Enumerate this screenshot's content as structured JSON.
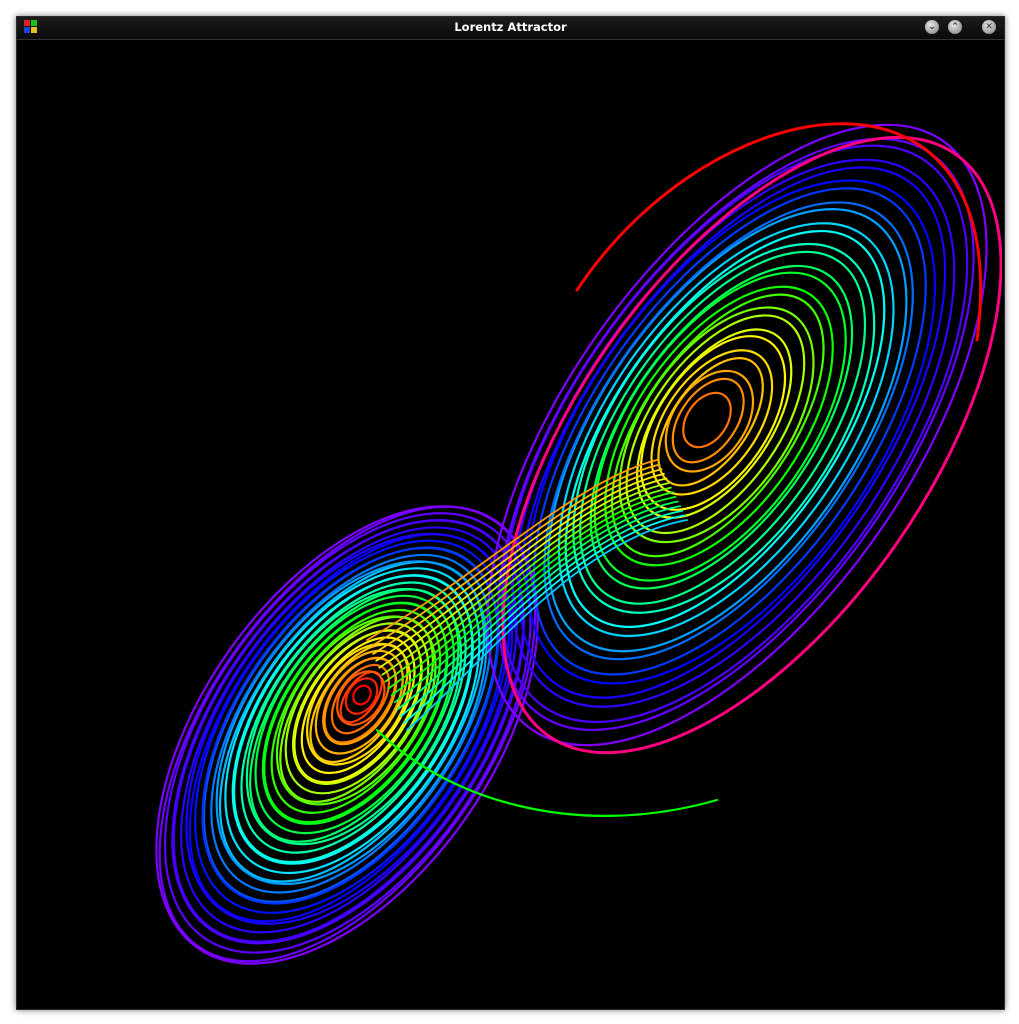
{
  "window": {
    "title": "Lorentz Attractor",
    "controls": {
      "minimize_icon": "chevron-down-icon",
      "maximize_icon": "chevron-up-icon",
      "close_icon": "close-icon"
    }
  },
  "canvas": {
    "background": "#000000",
    "colormap": [
      "#ff0000",
      "#ff8000",
      "#ffff00",
      "#00ff00",
      "#00ffff",
      "#0000ff",
      "#8000ff",
      "#ff0080"
    ],
    "curves_shown": "Lorenz attractor trajectory colored by a rainbow gradient"
  }
}
